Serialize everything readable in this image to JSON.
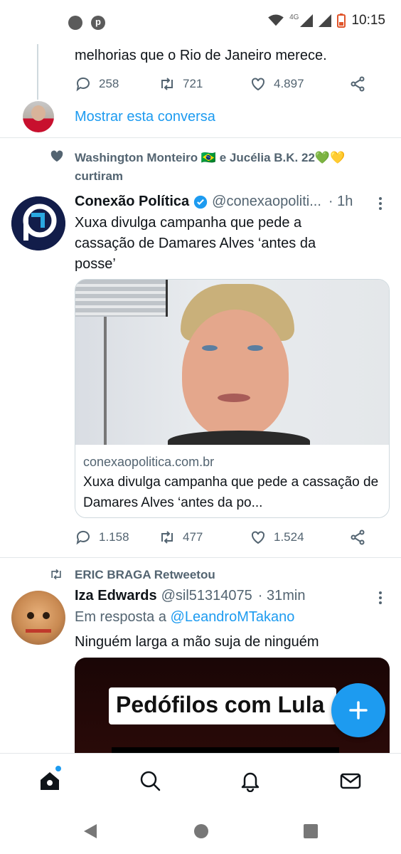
{
  "status_bar": {
    "time": "10:15",
    "network": "4G"
  },
  "thread_tail": {
    "text": "melhorias que o Rio de Janeiro merece.",
    "replies": "258",
    "retweets": "721",
    "likes": "4.897",
    "show_thread": "Mostrar esta conversa"
  },
  "tweet1": {
    "social_context_line1": "Washington Monteiro 🇧🇷 e Jucélia B.K. 22💚💛",
    "social_context_line2": "curtiram",
    "author_name": "Conexão Política",
    "author_handle": "@conexaopoliti...",
    "time": "· 1h",
    "text": "Xuxa divulga campanha que pede a cassação de Damares Alves ‘antes da posse’",
    "card_domain": "conexaopolitica.com.br",
    "card_title": "Xuxa divulga campanha que pede a cassação de Damares Alves ‘antes da po...",
    "replies": "1.158",
    "retweets": "477",
    "likes": "1.524"
  },
  "tweet2": {
    "social_context": "ERIC BRAGA Retweetou",
    "author_name": "Iza Edwards",
    "author_handle": "@sil51314075",
    "time": "· 31min",
    "reply_prefix": "Em resposta a ",
    "reply_to": "@LeandroMTakano",
    "text": "Ninguém larga a mão suja de ninguém",
    "media_text": "Pedófilos com Lula"
  },
  "colors": {
    "accent": "#1d9bf0",
    "text_secondary": "#536471",
    "verified": "#1d9bf0"
  },
  "icons": [
    "reply-icon",
    "retweet-icon",
    "like-icon",
    "share-icon",
    "home-icon",
    "search-icon",
    "notifications-icon",
    "messages-icon",
    "compose-icon"
  ]
}
